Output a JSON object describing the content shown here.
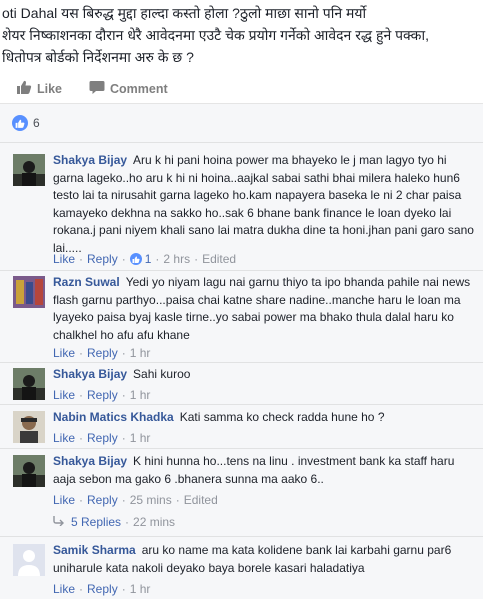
{
  "post": {
    "text": "oti Dahal यस बिरुद्ध मुद्दा हाल्दा कस्तो होला ?ठुलो माछा सानो पनि मर्यो\nशेयर निष्काशनका दौरान धेरै आवेदनमा एउटै चेक प्रयोग गर्नेको आवेदन रद्ध हुने पक्का,\nधितोपत्र बोर्डको निर्देशनमा अरु के छ ?"
  },
  "actions": {
    "like": "Like",
    "comment": "Comment"
  },
  "reactions": {
    "count": "6"
  },
  "colors": {
    "accent": "#365899",
    "link": "#4267b2",
    "like_blue": "#5890ff",
    "meta": "#90949c"
  },
  "comments": [
    {
      "author": "Shakya Bijay",
      "text": "Aru k hi pani hoina power ma bhayeko le j man lagyo tyo hi garna lageko..ho aru k hi ni hoina..aajkal sabai sathi bhai milera haleko hun6 testo lai ta nirusahit garna lageko ho.kam napayera baseka le ni 2 char paisa kamayeko dekhna na sakko ho..sak 6 bhane bank finance le loan dyeko lai rokana.j pani niyem khali sano lai matra dukha dine ta honi.jhan pani garo sano lai.....",
      "like": "Like",
      "reply": "Reply",
      "like_count": "1",
      "time": "2 hrs",
      "edited": "Edited"
    },
    {
      "author": "Razn Suwal",
      "text": "Yedi yo niyam lagu nai garnu thiyo ta ipo bhanda pahile nai news flash garnu parthyo...paisa chai katne share nadine..manche haru le loan ma lyayeko paisa byaj kasle tirne..yo sabai power ma bhako thula dalal haru ko chalkhel ho afu afu khane",
      "like": "Like",
      "reply": "Reply",
      "time": "1 hr"
    },
    {
      "author": "Shakya Bijay",
      "text": "Sahi kuroo",
      "like": "Like",
      "reply": "Reply",
      "time": "1 hr"
    },
    {
      "author": "Nabin Matics Khadka",
      "text": "Kati samma ko check radda hune ho ?",
      "like": "Like",
      "reply": "Reply",
      "time": "1 hr"
    },
    {
      "author": "Shakya Bijay",
      "text": "K hini hunna ho...tens na linu . investment bank ka staff haru aaja sebon ma gako 6 .bhanera sunna ma aako 6..",
      "like": "Like",
      "reply": "Reply",
      "time": "25 mins",
      "edited": "Edited"
    },
    {
      "author": "Samik Sharma",
      "text": "aru ko name ma kata kolidene bank lai karbahi garnu par6 uniharule kata nakoli deyako baya borele kasari haladatiya",
      "like": "Like",
      "reply": "Reply",
      "time": "1 hr"
    }
  ],
  "replies_summary": {
    "label": "5 Replies",
    "time": "22 mins"
  }
}
